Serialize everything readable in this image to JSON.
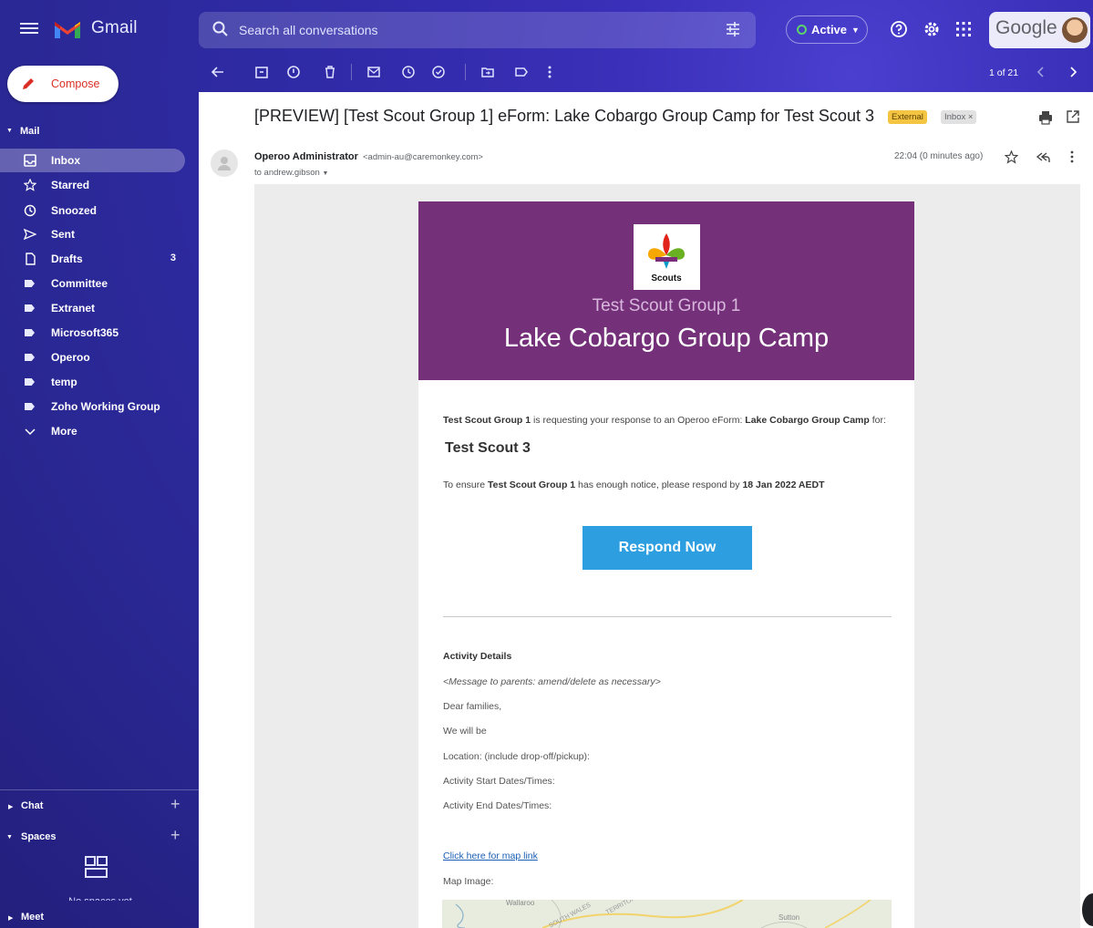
{
  "header": {
    "app_name": "Gmail",
    "search_placeholder": "Search all conversations",
    "status_label": "Active",
    "google_label": "Google"
  },
  "compose": {
    "label": "Compose"
  },
  "sidebar": {
    "mail_heading": "Mail",
    "items": [
      {
        "label": "Inbox",
        "icon": "inbox-icon",
        "active": true
      },
      {
        "label": "Starred",
        "icon": "star-icon"
      },
      {
        "label": "Snoozed",
        "icon": "clock-icon"
      },
      {
        "label": "Sent",
        "icon": "send-icon"
      },
      {
        "label": "Drafts",
        "icon": "draft-icon",
        "count": "3"
      },
      {
        "label": "Committee",
        "icon": "label-icon"
      },
      {
        "label": "Extranet",
        "icon": "label-icon"
      },
      {
        "label": "Microsoft365",
        "icon": "label-icon"
      },
      {
        "label": "Operoo",
        "icon": "label-icon"
      },
      {
        "label": "temp",
        "icon": "label-icon"
      },
      {
        "label": "Zoho Working Group",
        "icon": "label-icon"
      },
      {
        "label": "More",
        "icon": "chevron-down-icon"
      }
    ],
    "chat_heading": "Chat",
    "spaces_heading": "Spaces",
    "spaces_empty": "No spaces yet",
    "meet_heading": "Meet"
  },
  "toolbar": {
    "pagination": "1 of 21"
  },
  "email": {
    "subject": "[PREVIEW] [Test Scout Group 1] eForm: Lake Cobargo Group Camp for Test Scout 3",
    "labels": [
      "External",
      "Inbox ×"
    ],
    "sender_name": "Operoo Administrator",
    "sender_email": "<admin-au@caremonkey.com>",
    "to": "to andrew.gibson",
    "time": "22:04 (0 minutes ago)"
  },
  "body": {
    "logo_text": "Scouts",
    "group": "Test Scout Group 1",
    "camp": "Lake Cobargo Group Camp",
    "request_pre": "is requesting your response to an Operoo eForm:",
    "request_post": "for:",
    "scout": "Test Scout 3",
    "notice_pre": "To ensure",
    "notice_mid": "has enough notice, please respond by",
    "deadline": "18 Jan 2022 AEDT",
    "respond_button": "Respond Now",
    "activity_title": "Activity Details",
    "details": [
      "<Message to parents: amend/delete as necessary>",
      "Dear families,",
      "We will be",
      "Location: (include drop-off/pickup):",
      "Activity Start Dates/Times:",
      "Activity End Dates/Times:"
    ],
    "map_link": "Click here for map link",
    "map_image_label": "Map Image:",
    "map_labels": [
      "Wallaroo",
      "SOUTH WALES",
      "TERRITORY",
      "Sutton"
    ]
  },
  "colors": {
    "banner": "#74317a",
    "button": "#2d9ee0",
    "external_chip": "#f4c542",
    "link": "#1a5fb4"
  }
}
